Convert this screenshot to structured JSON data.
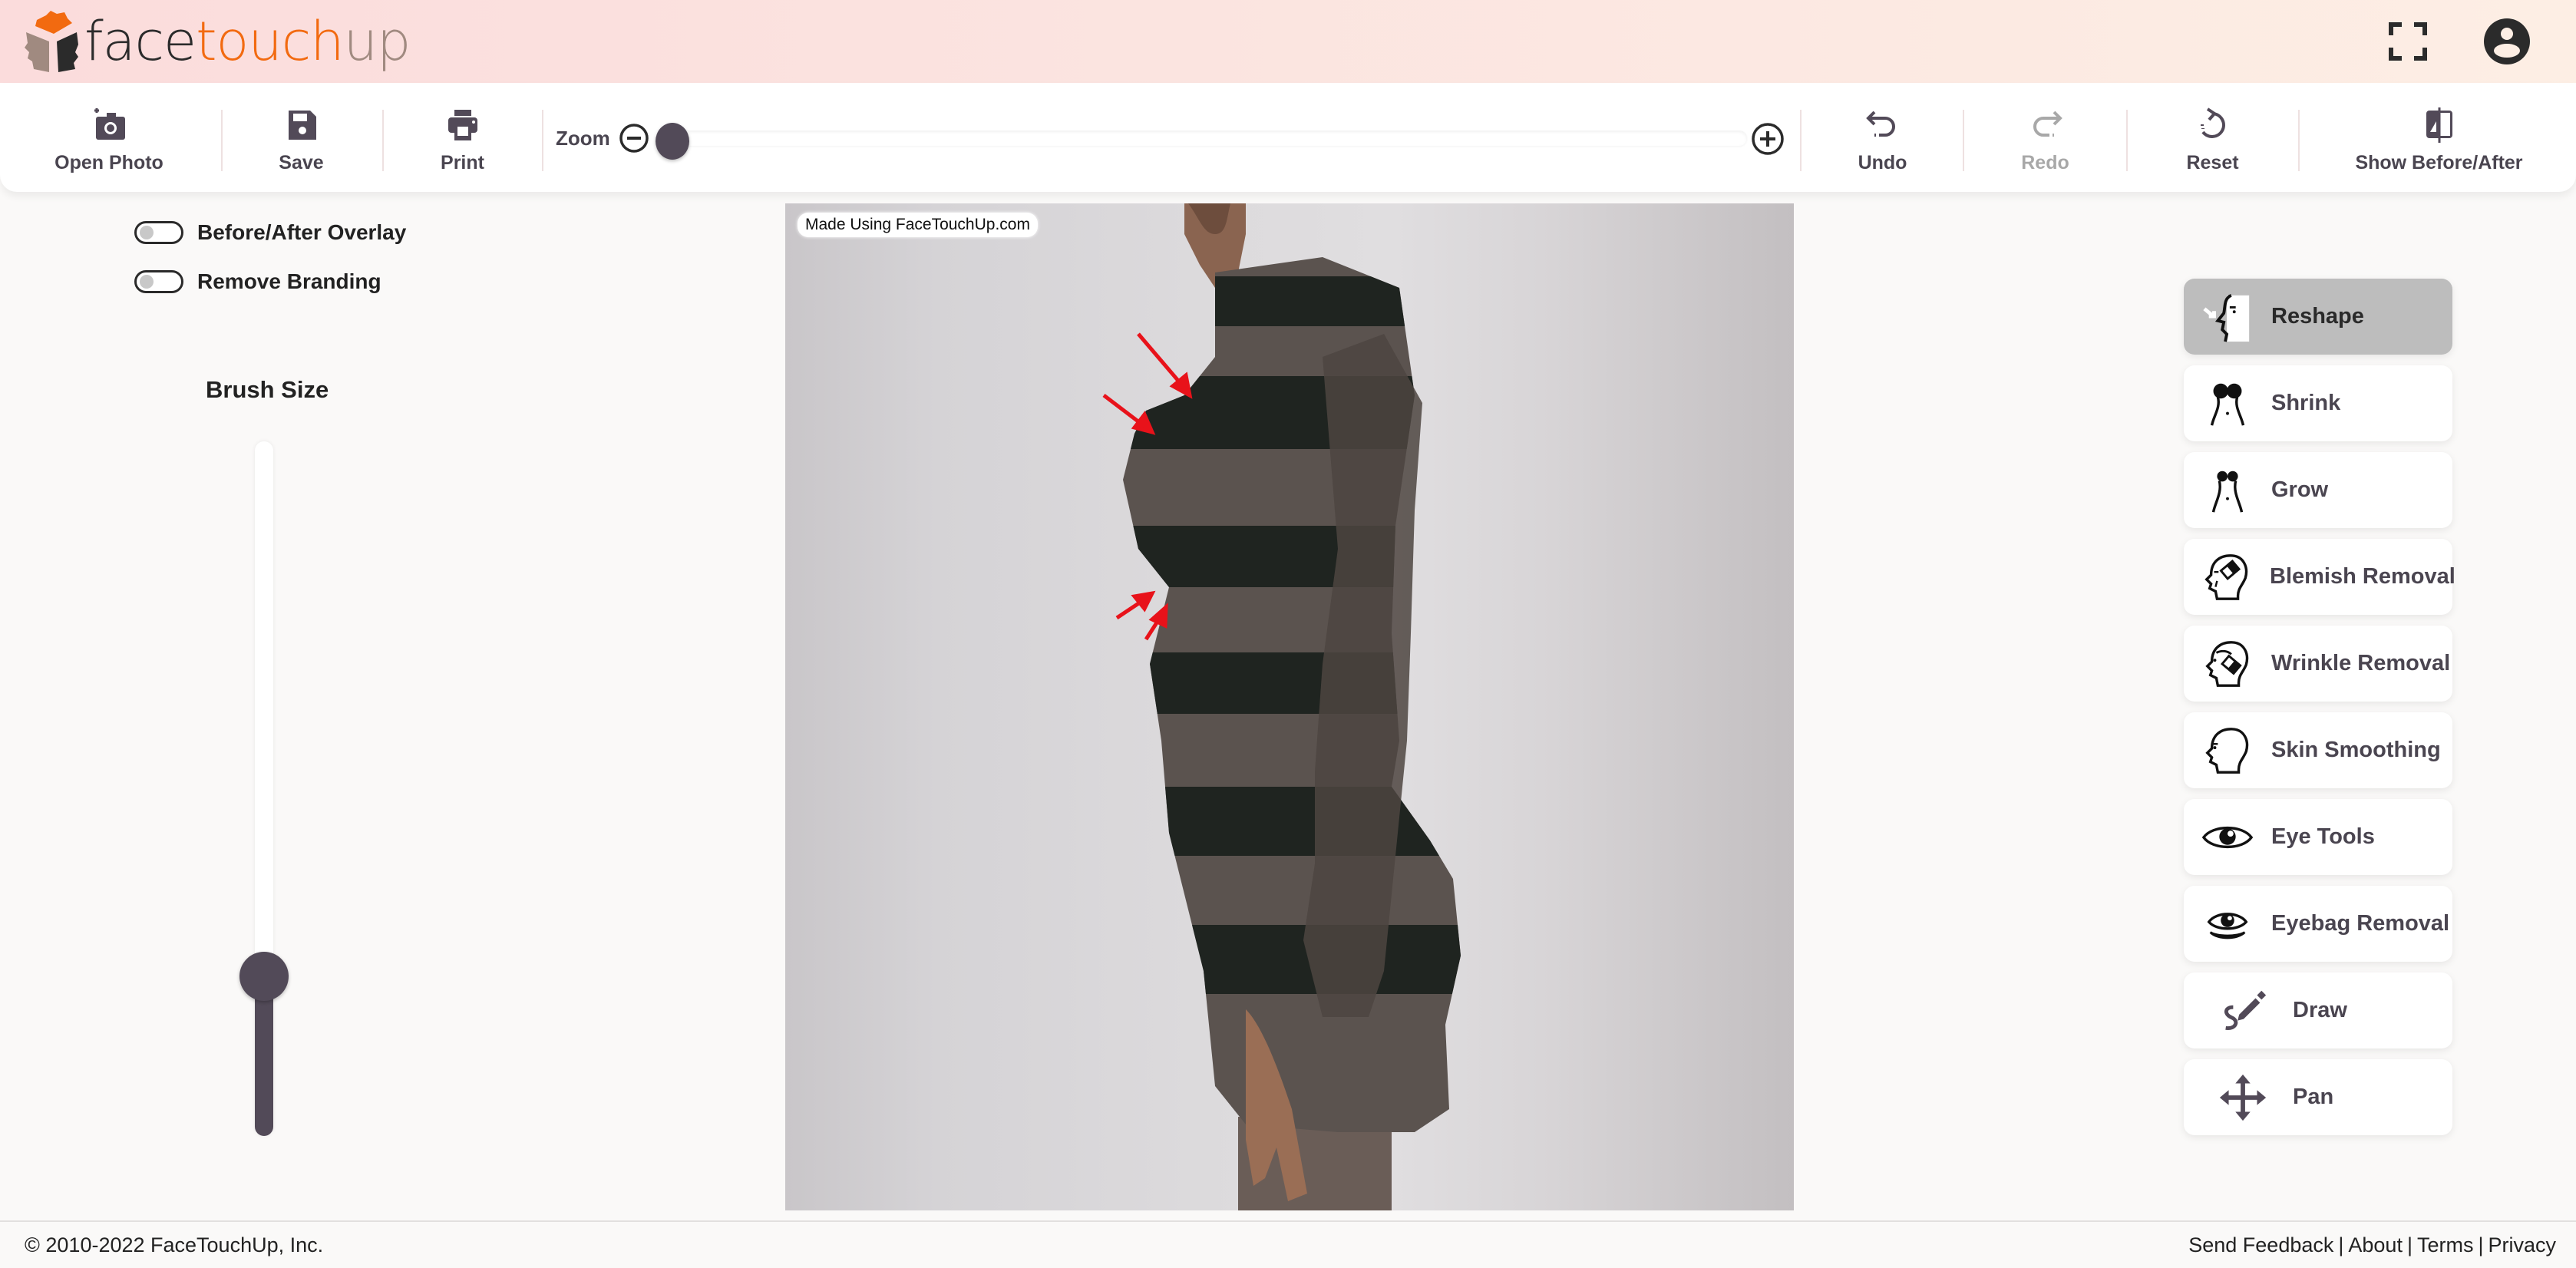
{
  "app": {
    "logo": {
      "part1": "face",
      "part2": "touch",
      "part3": "up"
    },
    "brand_colors": {
      "orange": "#f26a10",
      "dark": "#2b2b2b",
      "taupe": "#a08a80",
      "accent": "#524a58"
    }
  },
  "header": {
    "fullscreen_icon": "fullscreen-icon",
    "account_icon": "account-circle-icon"
  },
  "toolbar": {
    "open_photo": {
      "label": "Open Photo",
      "icon": "add-photo-icon"
    },
    "save": {
      "label": "Save",
      "icon": "floppy-disk-icon"
    },
    "print": {
      "label": "Print",
      "icon": "printer-icon"
    },
    "zoom": {
      "label": "Zoom",
      "value_percent": 0
    },
    "undo": {
      "label": "Undo",
      "icon": "undo-icon",
      "enabled": true
    },
    "redo": {
      "label": "Redo",
      "icon": "redo-icon",
      "enabled": false
    },
    "reset": {
      "label": "Reset",
      "icon": "reset-icon"
    },
    "before_after": {
      "label": "Show Before/After",
      "icon": "compare-icon"
    }
  },
  "left_panel": {
    "toggles": [
      {
        "label": "Before/After Overlay",
        "on": false
      },
      {
        "label": "Remove Branding",
        "on": false
      }
    ],
    "brush_size": {
      "label": "Brush Size",
      "value_percent": 23
    }
  },
  "canvas": {
    "watermark": "Made Using FaceTouchUp.com",
    "annotation_color": "#e8121a"
  },
  "tools": [
    {
      "label": "Reshape",
      "icon": "reshape-face-icon",
      "active": true
    },
    {
      "label": "Shrink",
      "icon": "shrink-body-icon",
      "active": false
    },
    {
      "label": "Grow",
      "icon": "grow-body-icon",
      "active": false
    },
    {
      "label": "Blemish Removal",
      "icon": "blemish-removal-icon",
      "active": false
    },
    {
      "label": "Wrinkle Removal",
      "icon": "wrinkle-removal-icon",
      "active": false
    },
    {
      "label": "Skin Smoothing",
      "icon": "skin-smoothing-icon",
      "active": false
    },
    {
      "label": "Eye Tools",
      "icon": "eye-icon",
      "active": false
    },
    {
      "label": "Eyebag Removal",
      "icon": "eyebag-icon",
      "active": false
    },
    {
      "label": "Draw",
      "icon": "draw-pen-icon",
      "active": false
    },
    {
      "label": "Pan",
      "icon": "pan-arrows-icon",
      "active": false
    }
  ],
  "footer": {
    "copyright": "© 2010-2022 FaceTouchUp, Inc.",
    "links": [
      "Send Feedback",
      "About",
      "Terms",
      "Privacy"
    ],
    "separator": "|"
  }
}
